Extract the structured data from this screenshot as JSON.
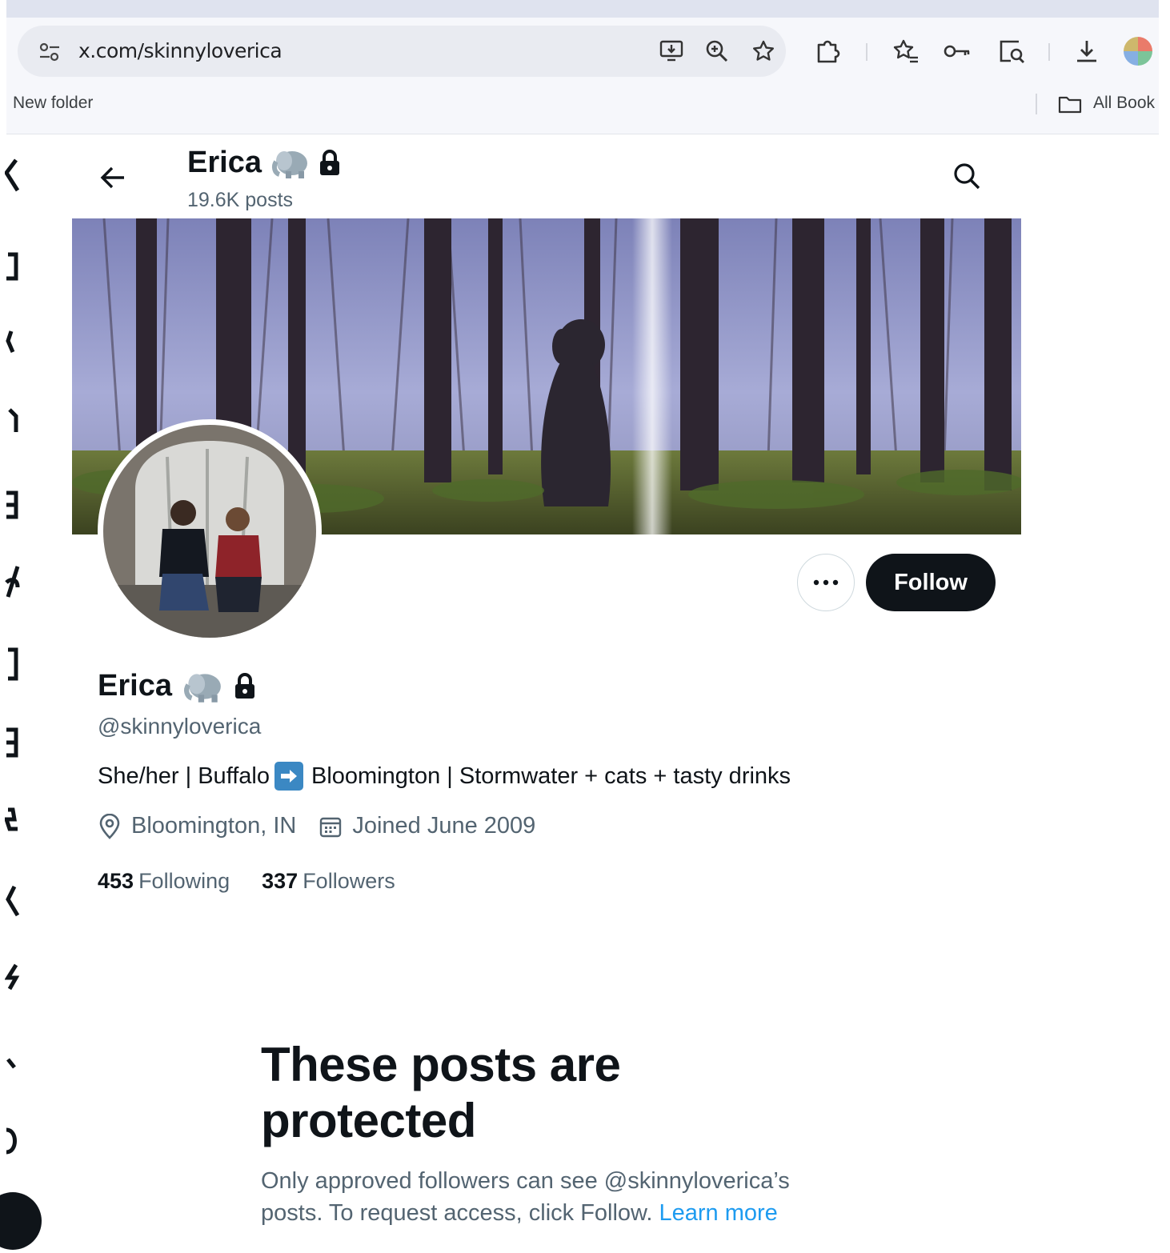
{
  "browser": {
    "url": "x.com/skinnyloverica",
    "bookmarks_bar": {
      "folder": "New folder",
      "all_bookmarks": "All Book"
    }
  },
  "header": {
    "name": "Erica",
    "posts_count": "19.6K posts"
  },
  "profile": {
    "name": "Erica",
    "handle": "@skinnyloverica",
    "bio_parts": [
      "She/her | Buffalo",
      "Bloomington | Stormwater + cats + tasty drinks"
    ],
    "location": "Bloomington, IN",
    "joined": "Joined June 2009",
    "following_count": "453",
    "following_label": "Following",
    "followers_count": "337",
    "followers_label": "Followers",
    "follow_label": "Follow"
  },
  "protected": {
    "title": "These posts are protected",
    "text": "Only approved followers can see @skinnyloverica’s posts. To request access, click Follow.",
    "link": "Learn more"
  },
  "colors": {
    "accent_link": "#1d9bf0",
    "follow_bg": "#0f1419",
    "secondary_text": "#536471",
    "arrow_emoji_bg": "#3b88c3"
  }
}
